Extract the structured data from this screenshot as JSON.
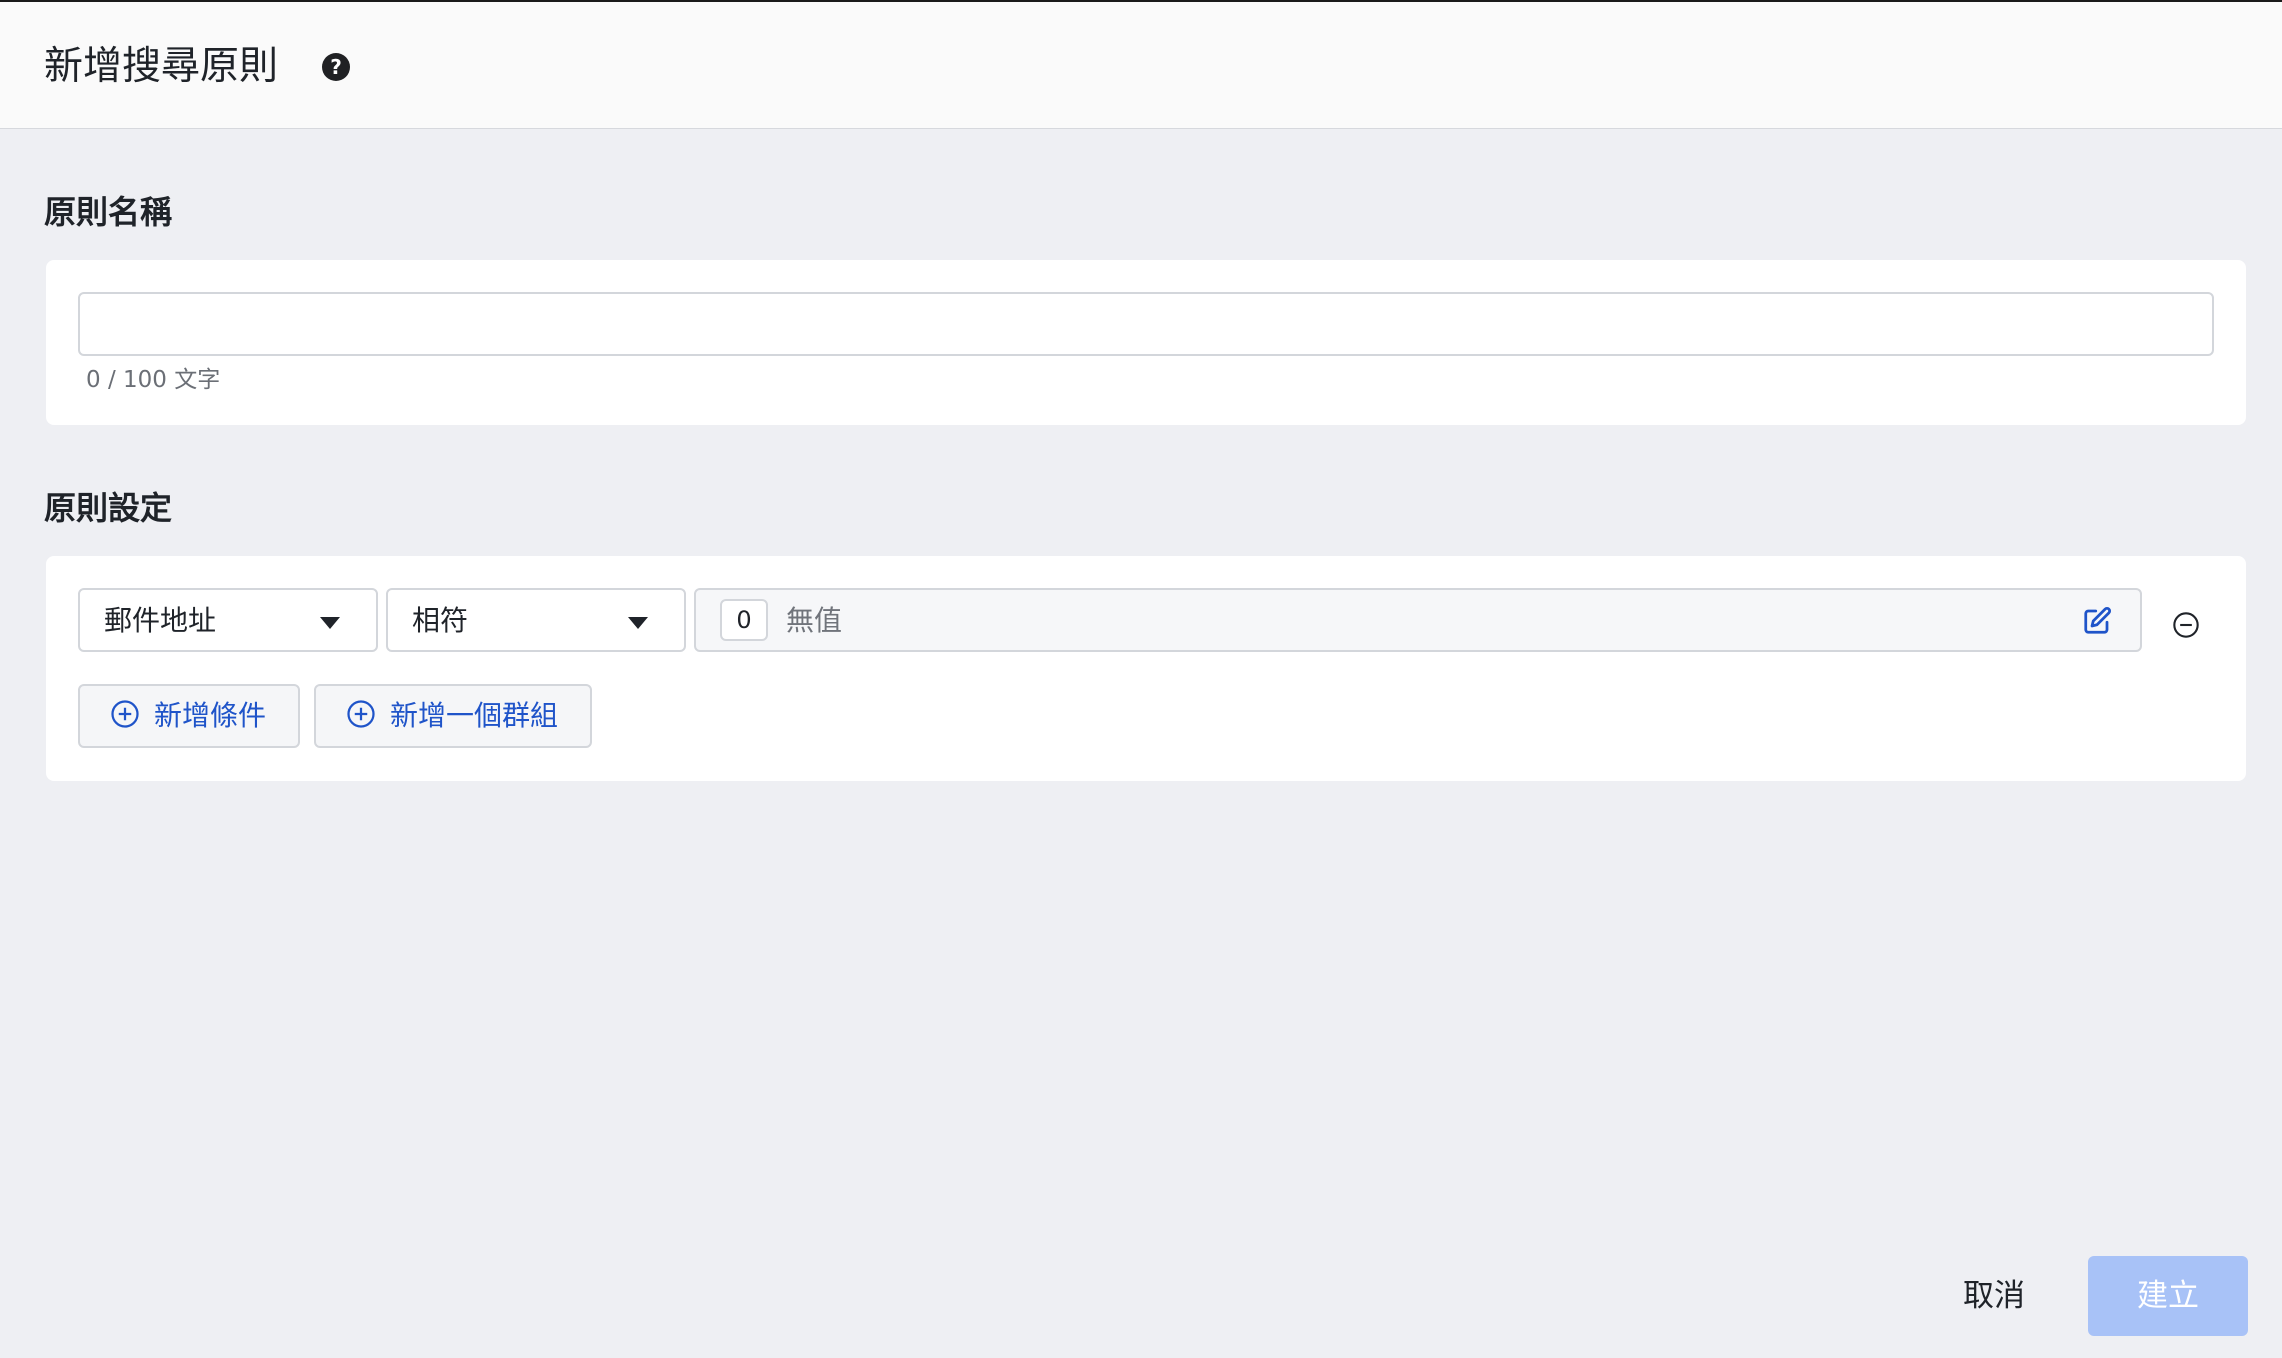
{
  "header": {
    "title": "新增搜尋原則",
    "help_icon": "question-circle-icon"
  },
  "rule_name": {
    "section_title": "原則名稱",
    "input_value": "",
    "input_placeholder": "",
    "char_count": "0 / 100 文字"
  },
  "rule_settings": {
    "section_title": "原則設定",
    "condition": {
      "field_select": "郵件地址",
      "operator_select": "相符",
      "value_count": "0",
      "value_text": "無值",
      "edit_icon": "edit-icon",
      "remove_icon": "minus-circle-icon"
    },
    "add_condition_label": "新增條件",
    "add_group_label": "新增一個群組"
  },
  "footer": {
    "cancel_label": "取消",
    "create_label": "建立"
  },
  "colors": {
    "accent_blue": "#1f54c9",
    "create_button_disabled": "#a8c2f7",
    "page_background": "#eeeff3"
  }
}
